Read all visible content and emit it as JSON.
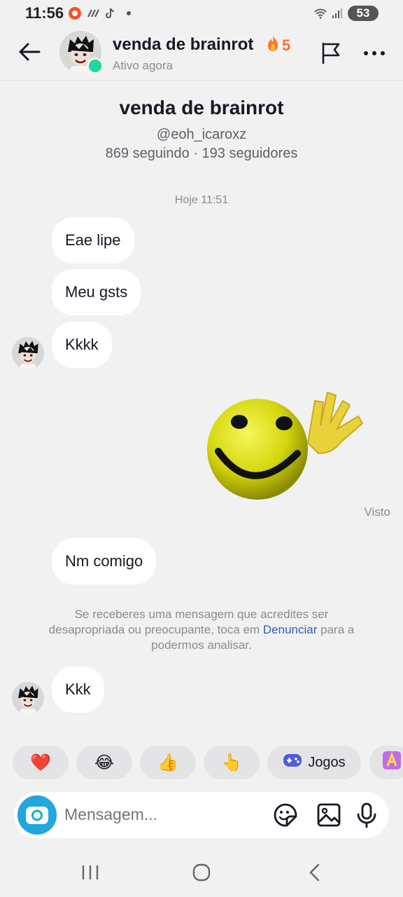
{
  "status_bar": {
    "time": "11:56",
    "battery": "53"
  },
  "header": {
    "title": "venda de brainrot",
    "streak_count": "5",
    "status": "Ativo agora"
  },
  "profile": {
    "name": "venda de brainrot",
    "handle": "@eoh_icaroxz",
    "stats": "869 seguindo · 193 seguidores"
  },
  "chat": {
    "timestamp": "Hoje 11:51",
    "messages": [
      "Eae lipe",
      "Meu gsts",
      "Kkkk",
      "Nm comigo",
      "Kkk"
    ],
    "seen_label": "Visto",
    "notice": {
      "before": "Se receberes uma mensagem que acredites ser desapropriada ou preocupante, toca em",
      "link": "Denunciar",
      "after": "para a podermos analisar."
    }
  },
  "quick_replies": {
    "items": [
      "❤️",
      "😂",
      "👍",
      "👆"
    ],
    "games_label": "Jogos"
  },
  "composer": {
    "placeholder": "Mensagem..."
  },
  "colors": {
    "accent_blue": "#21a7dc",
    "streak": "#fe6d2c",
    "online": "#20d5a0",
    "link": "#2b5db9"
  }
}
